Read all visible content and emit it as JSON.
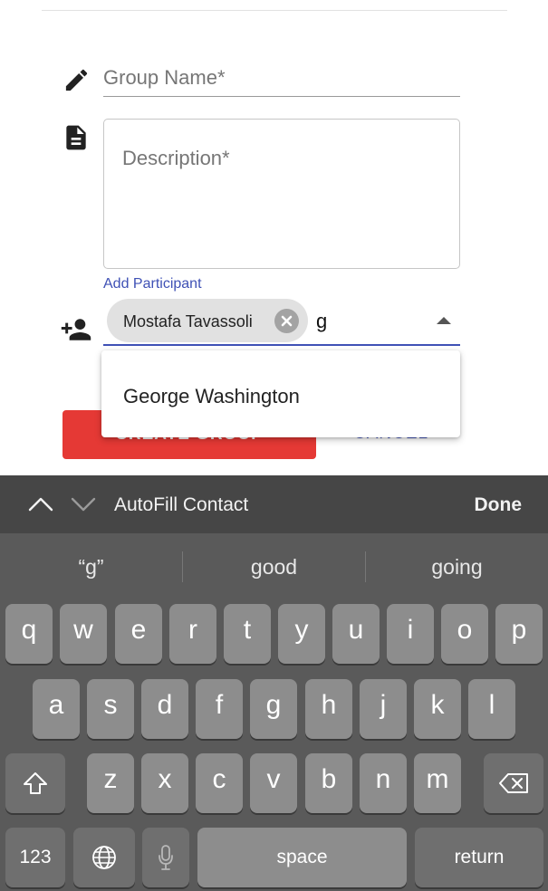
{
  "form": {
    "group_name_placeholder": "Group Name*",
    "description_placeholder": "Description*",
    "add_participant_label": "Add Participant",
    "participant_chip": "Mostafa Tavassoli",
    "participant_query": "g",
    "suggestion_option": "George Washington",
    "create_button_label": "CREATE GROUP",
    "cancel_button_label": "CANCEL"
  },
  "keyboard": {
    "autofill_label": "AutoFill Contact",
    "done_label": "Done",
    "suggestions": [
      "“g”",
      "good",
      "going"
    ],
    "row1": [
      "q",
      "w",
      "e",
      "r",
      "t",
      "y",
      "u",
      "i",
      "o",
      "p"
    ],
    "row2": [
      "a",
      "s",
      "d",
      "f",
      "g",
      "h",
      "j",
      "k",
      "l"
    ],
    "row3": [
      "z",
      "x",
      "c",
      "v",
      "b",
      "n",
      "m"
    ],
    "numbers_label": "123",
    "space_label": "space",
    "return_label": "return"
  },
  "colors": {
    "accent": "#3f51b5",
    "danger": "#e53935",
    "keyboard_bg": "#5a5a5a",
    "key_bg": "#8d8d8d"
  },
  "icons": [
    "pencil-icon",
    "document-icon",
    "add-person-icon",
    "chip-delete-icon",
    "dropdown-arrow-icon",
    "chevron-up-icon",
    "chevron-down-icon",
    "shift-icon",
    "backspace-icon",
    "globe-icon",
    "microphone-icon"
  ]
}
